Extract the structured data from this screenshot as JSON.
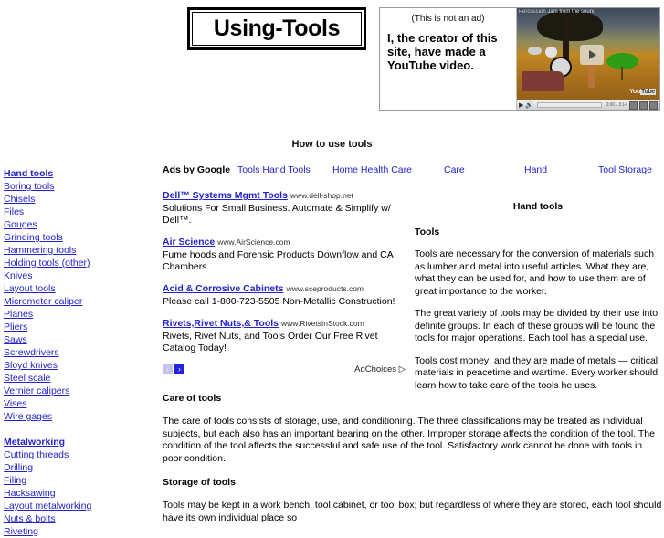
{
  "site": {
    "logo": "Using-Tools",
    "page_title": "How to use tools"
  },
  "promo": {
    "disclaimer": "(This is not an ad)",
    "message": "I, the creator of this site, have made a YouTube video.",
    "video_title": "Percussion Jam from the sound",
    "video_logo": "You",
    "video_logo_mark": "Tube"
  },
  "sidebar": {
    "groups": [
      {
        "heading": "Hand tools",
        "items": [
          "Boring tools",
          "Chisels",
          "Files",
          "Gouges",
          "Grinding tools",
          "Hammering tools",
          "Holding tools (other)",
          "Knives",
          "Layout tools",
          "Micrometer caliper",
          "Planes",
          "Pliers",
          "Saws",
          "Screwdrivers",
          "Sloyd knives",
          "Steel scale",
          "Vernier calipers",
          "Vises",
          "Wire gages"
        ]
      },
      {
        "heading": "Metalworking",
        "items": [
          "Cutting threads",
          "Drilling",
          "Filing",
          "Hacksawing",
          "Layout metalworking",
          "Nuts & bolts",
          "Riveting"
        ]
      }
    ]
  },
  "ads": {
    "label": "Ads by Google",
    "keywords": [
      "Tools Hand Tools",
      "Home Health Care",
      "Care",
      "Hand",
      "Tool Storage"
    ],
    "items": [
      {
        "title": "Dell™ Systems Mgmt Tools",
        "url": "www.dell-shop.net",
        "desc": "Solutions For Small Business. Automate & Simplify w/ Dell™."
      },
      {
        "title": "Air Science",
        "url": "www.AirScience.com",
        "desc": "Fume hoods and Forensic Products Downflow and CA Chambers"
      },
      {
        "title": "Acid & Corrosive Cabinets",
        "url": "www.sceproducts.com",
        "desc": "Please call 1-800-723-5505 Non-Metallic Construction!"
      },
      {
        "title": "Rivets,Rivet Nuts,& Tools",
        "url": "www.RivetsInStock.com",
        "desc": "Rivets, Rivet Nuts, and Tools Order Our Free Rivet Catalog Today!"
      }
    ],
    "prev_arrow": "‹",
    "next_arrow": "›",
    "adchoices": "AdChoices ▷"
  },
  "article": {
    "heading": "Hand tools",
    "section_tools": "Tools",
    "p1": "Tools are necessary for the conversion of materials such as lumber and metal into useful articles. What they are, what they can be used for, and how to use them are of great importance to the worker.",
    "p2": "The great variety of tools may be divided by their use into definite groups. In each of these groups will be found the tools for major operations. Each tool has a special use.",
    "p3": "Tools cost money; and they are made of metals — critical materials in peacetime and wartime. Every worker should learn how to take care of the tools he uses.",
    "section_care": "Care of tools",
    "p4": "The care of tools consists of storage, use, and conditioning. The three classifications may be treated as individual subjects, but each also has an important bearing on the other. Improper storage affects the condition of the tool. The condition of the tool affects the successful and safe use of the tool. Satisfactory work cannot be done with tools in poor condition.",
    "section_storage": "Storage of tools",
    "p5": "Tools may be kept in a work bench, tool cabinet, or tool box; but regardless of where they are stored, each tool should have its own individual place so"
  },
  "colors": {
    "link": "#2222CC",
    "text": "#000000",
    "ad_arrow_active": "#2323DD",
    "ad_arrow_disabled": "#C3C3F0"
  }
}
